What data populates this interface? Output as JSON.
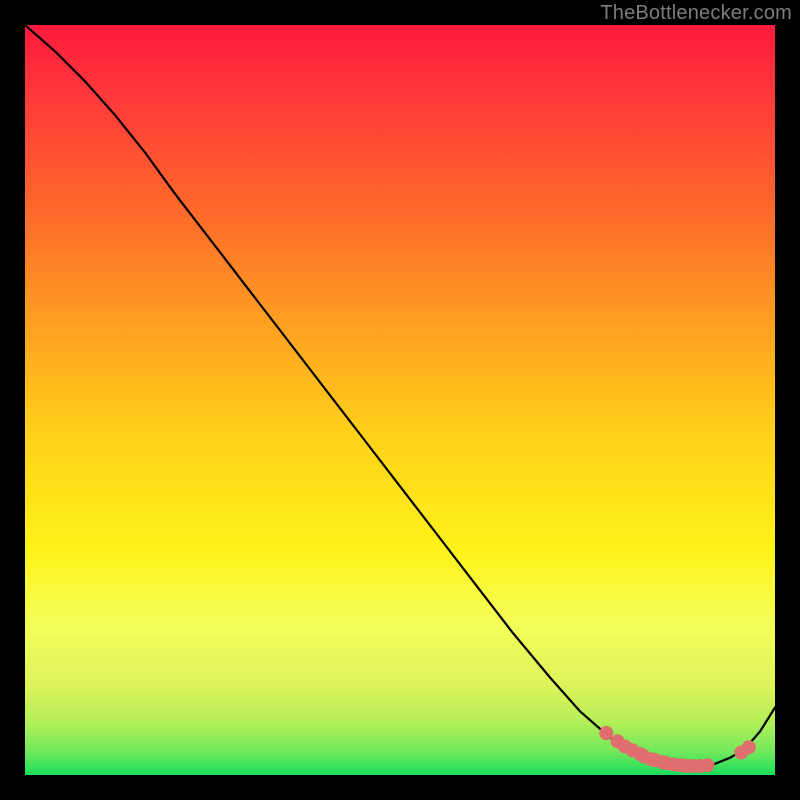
{
  "watermark": "TheBottlenecker.com",
  "chart_data": {
    "type": "line",
    "title": "",
    "xlabel": "",
    "ylabel": "",
    "xlim": [
      0,
      1
    ],
    "ylim": [
      0,
      1
    ],
    "series": [
      {
        "name": "curve",
        "x": [
          0.0,
          0.04,
          0.08,
          0.12,
          0.16,
          0.2,
          0.25,
          0.3,
          0.35,
          0.4,
          0.45,
          0.5,
          0.55,
          0.6,
          0.65,
          0.7,
          0.74,
          0.78,
          0.8,
          0.82,
          0.84,
          0.86,
          0.88,
          0.9,
          0.92,
          0.94,
          0.96,
          0.98,
          1.0
        ],
        "y": [
          1.0,
          0.965,
          0.925,
          0.88,
          0.83,
          0.775,
          0.71,
          0.645,
          0.58,
          0.515,
          0.45,
          0.385,
          0.32,
          0.255,
          0.19,
          0.13,
          0.085,
          0.05,
          0.037,
          0.027,
          0.02,
          0.015,
          0.012,
          0.012,
          0.015,
          0.023,
          0.035,
          0.058,
          0.09
        ]
      }
    ],
    "markers": {
      "name": "highlight-points",
      "color": "#e06e6e",
      "x": [
        0.775,
        0.79,
        0.8,
        0.81,
        0.82,
        0.825,
        0.835,
        0.84,
        0.85,
        0.855,
        0.865,
        0.875,
        0.883,
        0.89,
        0.9,
        0.91,
        0.955,
        0.965
      ],
      "y": [
        0.056,
        0.045,
        0.038,
        0.033,
        0.028,
        0.025,
        0.021,
        0.02,
        0.017,
        0.016,
        0.014,
        0.013,
        0.012,
        0.012,
        0.012,
        0.013,
        0.03,
        0.037
      ]
    }
  }
}
